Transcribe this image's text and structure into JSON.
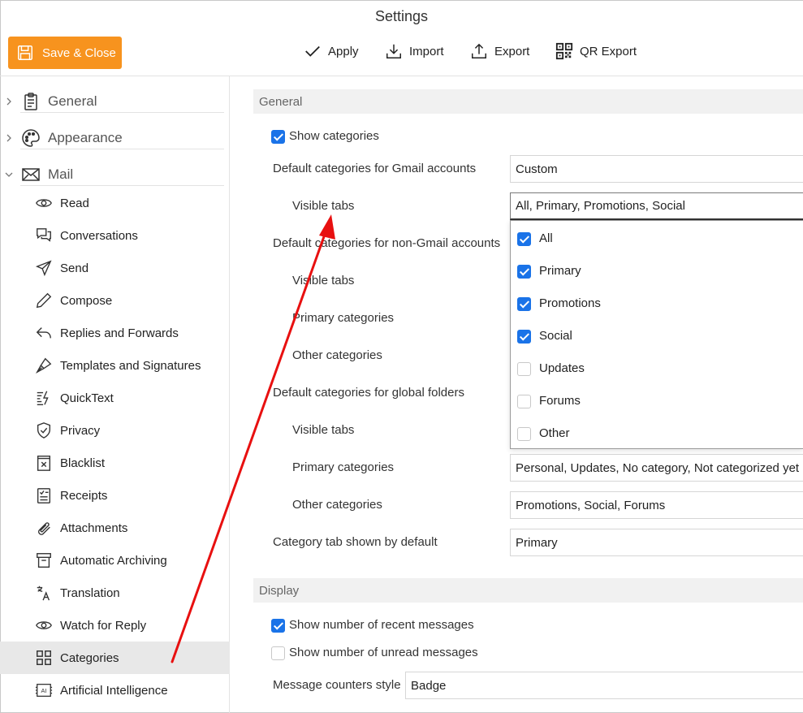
{
  "window": {
    "title": "Settings"
  },
  "toolbar": {
    "save_close": "Save & Close",
    "apply": "Apply",
    "import": "Import",
    "export": "Export",
    "qr_export": "QR Export"
  },
  "sidebar": {
    "sections": [
      {
        "label": "General",
        "icon": "clipboard-icon",
        "expanded": false
      },
      {
        "label": "Appearance",
        "icon": "palette-icon",
        "expanded": false
      },
      {
        "label": "Mail",
        "icon": "mail-icon",
        "expanded": true
      }
    ],
    "items": [
      {
        "label": "Read",
        "icon": "eye-icon"
      },
      {
        "label": "Conversations",
        "icon": "conversations-icon"
      },
      {
        "label": "Send",
        "icon": "send-icon"
      },
      {
        "label": "Compose",
        "icon": "pencil-icon"
      },
      {
        "label": "Replies and Forwards",
        "icon": "reply-icon"
      },
      {
        "label": "Templates and Signatures",
        "icon": "pen-nib-icon"
      },
      {
        "label": "QuickText",
        "icon": "quicktext-icon"
      },
      {
        "label": "Privacy",
        "icon": "shield-icon"
      },
      {
        "label": "Blacklist",
        "icon": "blacklist-icon"
      },
      {
        "label": "Receipts",
        "icon": "receipt-icon"
      },
      {
        "label": "Attachments",
        "icon": "paperclip-icon"
      },
      {
        "label": "Automatic Archiving",
        "icon": "archive-icon"
      },
      {
        "label": "Translation",
        "icon": "translate-icon"
      },
      {
        "label": "Watch for Reply",
        "icon": "eye-icon"
      },
      {
        "label": "Categories",
        "icon": "grid-icon",
        "active": true
      },
      {
        "label": "Artificial Intelligence",
        "icon": "ai-icon"
      }
    ]
  },
  "general": {
    "header": "General",
    "show_categories": {
      "label": "Show categories",
      "checked": true
    },
    "gmail_defaults": {
      "label": "Default categories for Gmail accounts",
      "value": "Custom"
    },
    "gmail_visible_tabs": {
      "label": "Visible tabs",
      "value": "All, Primary, Promotions, Social"
    },
    "non_gmail_defaults": {
      "label": "Default categories for non-Gmail accounts"
    },
    "non_gmail_visible_tabs": {
      "label": "Visible tabs"
    },
    "non_gmail_primary": {
      "label": "Primary categories"
    },
    "non_gmail_other": {
      "label": "Other categories"
    },
    "global_defaults": {
      "label": "Default categories for global folders"
    },
    "global_visible_tabs": {
      "label": "Visible tabs"
    },
    "global_primary": {
      "label": "Primary categories",
      "value": "Personal, Updates, No category, Not categorized yet"
    },
    "global_other": {
      "label": "Other categories",
      "value": "Promotions, Social, Forums"
    },
    "default_tab": {
      "label": "Category tab shown by default",
      "value": "Primary"
    }
  },
  "dropdown": {
    "options": [
      {
        "label": "All",
        "checked": true
      },
      {
        "label": "Primary",
        "checked": true
      },
      {
        "label": "Promotions",
        "checked": true
      },
      {
        "label": "Social",
        "checked": true
      },
      {
        "label": "Updates",
        "checked": false
      },
      {
        "label": "Forums",
        "checked": false
      },
      {
        "label": "Other",
        "checked": false
      }
    ]
  },
  "display": {
    "header": "Display",
    "recent": {
      "label": "Show number of recent messages",
      "checked": true
    },
    "unread": {
      "label": "Show number of unread messages",
      "checked": false
    },
    "counter_style": {
      "label": "Message counters style",
      "value": "Badge"
    }
  },
  "colors": {
    "accent": "#f7931e",
    "checkbox": "#1a73e8",
    "annotation_arrow": "#e81010"
  }
}
